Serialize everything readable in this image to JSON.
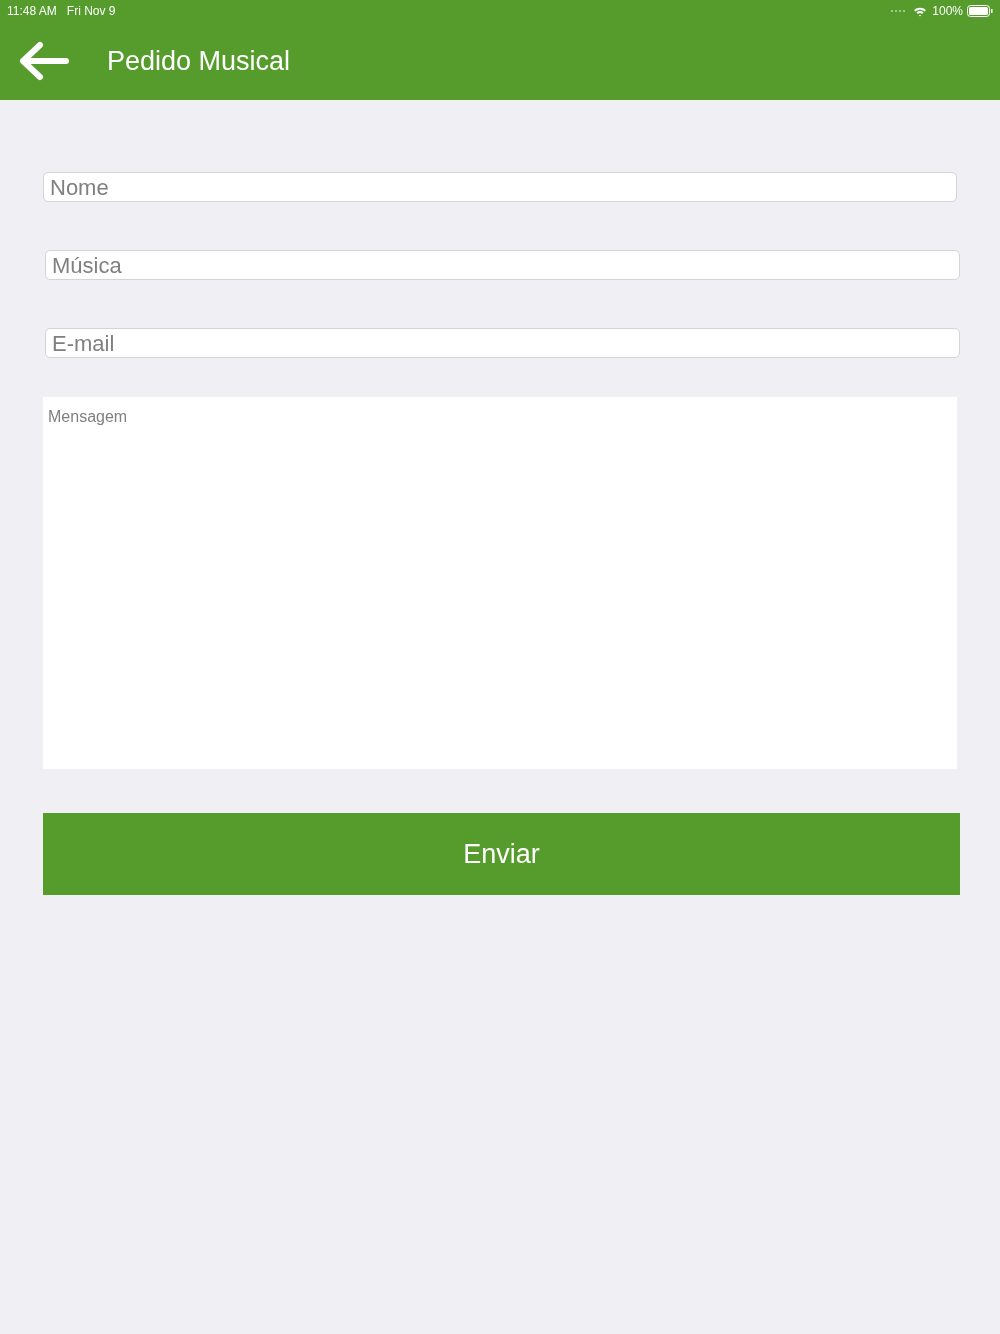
{
  "status_bar": {
    "time": "11:48 AM",
    "date": "Fri Nov 9",
    "battery": "100%"
  },
  "header": {
    "title": "Pedido Musical"
  },
  "fields": [
    {
      "kind": "line",
      "placeholder": "Nome"
    },
    {
      "kind": "line",
      "placeholder": "Música"
    },
    {
      "kind": "line",
      "placeholder": "E-mail"
    },
    {
      "kind": "area",
      "placeholder": "Mensagem"
    }
  ],
  "submit": {
    "label": "Enviar"
  }
}
